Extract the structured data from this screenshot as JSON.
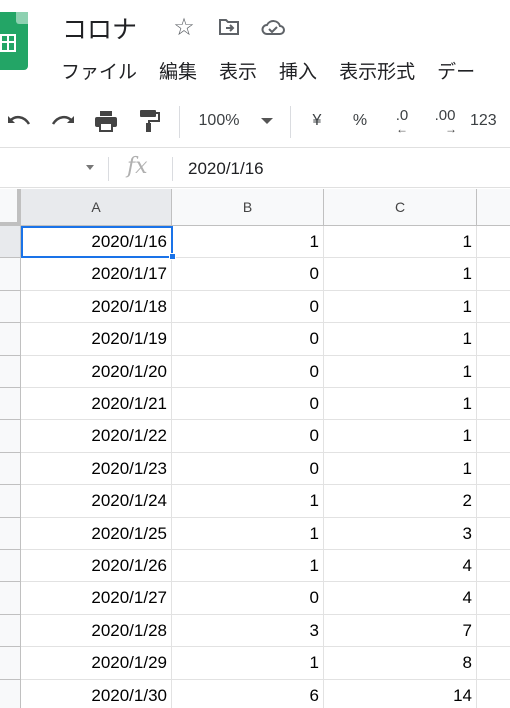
{
  "app": {
    "doc_title": "コロナ",
    "icons": [
      "sheets-logo",
      "star-icon",
      "move-to-folder-icon",
      "cloud-saved-icon"
    ]
  },
  "menu": [
    "ファイル",
    "編集",
    "表示",
    "挿入",
    "表示形式",
    "デー"
  ],
  "toolbar": {
    "zoom": "100%",
    "currency": "¥",
    "percent": "%",
    "decrease_decimal": ".0",
    "increase_decimal": ".00",
    "more_formats": "123"
  },
  "formula_bar": {
    "fx": "fx",
    "value": "2020/1/16"
  },
  "columns": [
    "A",
    "B",
    "C"
  ],
  "rows": [
    [
      "2020/1/16",
      "1",
      "1"
    ],
    [
      "2020/1/17",
      "0",
      "1"
    ],
    [
      "2020/1/18",
      "0",
      "1"
    ],
    [
      "2020/1/19",
      "0",
      "1"
    ],
    [
      "2020/1/20",
      "0",
      "1"
    ],
    [
      "2020/1/21",
      "0",
      "1"
    ],
    [
      "2020/1/22",
      "0",
      "1"
    ],
    [
      "2020/1/23",
      "0",
      "1"
    ],
    [
      "2020/1/24",
      "1",
      "2"
    ],
    [
      "2020/1/25",
      "1",
      "3"
    ],
    [
      "2020/1/26",
      "1",
      "4"
    ],
    [
      "2020/1/27",
      "0",
      "4"
    ],
    [
      "2020/1/28",
      "3",
      "7"
    ],
    [
      "2020/1/29",
      "1",
      "8"
    ],
    [
      "2020/1/30",
      "6",
      "14"
    ]
  ],
  "colors": {
    "accent": "#1a73e8",
    "sheets_green": "#23a566"
  }
}
